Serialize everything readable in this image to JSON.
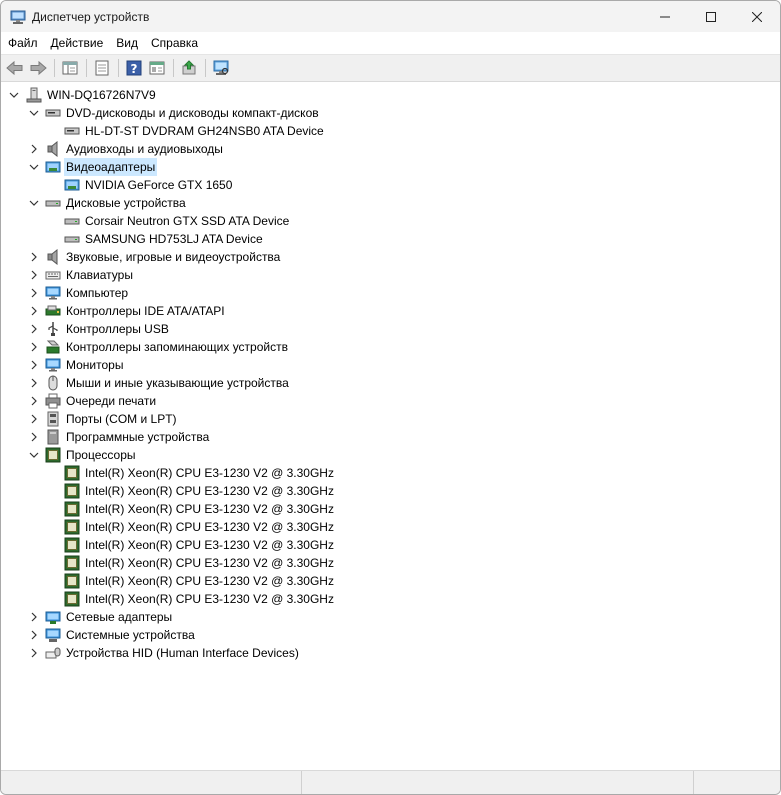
{
  "window": {
    "title": "Диспетчер устройств"
  },
  "menu": [
    "Файл",
    "Действие",
    "Вид",
    "Справка"
  ],
  "toolbar_icons": [
    "back-icon",
    "forward-icon",
    "show-hide-tree-icon",
    "properties-icon",
    "help-icon",
    "run-view-icon",
    "update-driver-icon",
    "scan-hardware-icon"
  ],
  "tree": {
    "root": "WIN-DQ16726N7V9",
    "categories": [
      {
        "label": "DVD-дисководы и дисководы компакт-дисков",
        "icon": "dvd-drive-icon",
        "expanded": true,
        "children": [
          "HL-DT-ST DVDRAM GH24NSB0 ATA Device"
        ]
      },
      {
        "label": "Аудиовходы и аудиовыходы",
        "icon": "speaker-icon",
        "expanded": false,
        "children": []
      },
      {
        "label": "Видеоадаптеры",
        "icon": "display-adapter-icon",
        "expanded": true,
        "selected": true,
        "children": [
          "NVIDIA GeForce GTX 1650"
        ]
      },
      {
        "label": "Дисковые устройства",
        "icon": "disk-drive-icon",
        "expanded": true,
        "children": [
          "Corsair Neutron GTX SSD ATA Device",
          "SAMSUNG HD753LJ ATA Device"
        ]
      },
      {
        "label": "Звуковые, игровые и видеоустройства",
        "icon": "speaker-icon",
        "expanded": false,
        "children": []
      },
      {
        "label": "Клавиатуры",
        "icon": "keyboard-icon",
        "expanded": false,
        "children": []
      },
      {
        "label": "Компьютер",
        "icon": "monitor-icon",
        "expanded": false,
        "children": []
      },
      {
        "label": "Контроллеры IDE ATA/ATAPI",
        "icon": "ide-controller-icon",
        "expanded": false,
        "children": []
      },
      {
        "label": "Контроллеры USB",
        "icon": "usb-icon",
        "expanded": false,
        "children": []
      },
      {
        "label": "Контроллеры запоминающих устройств",
        "icon": "storage-controller-icon",
        "expanded": false,
        "children": []
      },
      {
        "label": "Мониторы",
        "icon": "monitor-icon",
        "expanded": false,
        "children": []
      },
      {
        "label": "Мыши и иные указывающие устройства",
        "icon": "mouse-icon",
        "expanded": false,
        "children": []
      },
      {
        "label": "Очереди печати",
        "icon": "printer-icon",
        "expanded": false,
        "children": []
      },
      {
        "label": "Порты (COM и LPT)",
        "icon": "port-icon",
        "expanded": false,
        "children": []
      },
      {
        "label": "Программные устройства",
        "icon": "software-device-icon",
        "expanded": false,
        "children": []
      },
      {
        "label": "Процессоры",
        "icon": "processor-icon",
        "expanded": true,
        "children": [
          "Intel(R) Xeon(R) CPU E3-1230 V2 @ 3.30GHz",
          "Intel(R) Xeon(R) CPU E3-1230 V2 @ 3.30GHz",
          "Intel(R) Xeon(R) CPU E3-1230 V2 @ 3.30GHz",
          "Intel(R) Xeon(R) CPU E3-1230 V2 @ 3.30GHz",
          "Intel(R) Xeon(R) CPU E3-1230 V2 @ 3.30GHz",
          "Intel(R) Xeon(R) CPU E3-1230 V2 @ 3.30GHz",
          "Intel(R) Xeon(R) CPU E3-1230 V2 @ 3.30GHz",
          "Intel(R) Xeon(R) CPU E3-1230 V2 @ 3.30GHz"
        ]
      },
      {
        "label": "Сетевые адаптеры",
        "icon": "network-adapter-icon",
        "expanded": false,
        "children": []
      },
      {
        "label": "Системные устройства",
        "icon": "system-device-icon",
        "expanded": false,
        "children": []
      },
      {
        "label": "Устройства HID (Human Interface Devices)",
        "icon": "hid-icon",
        "expanded": false,
        "children": []
      }
    ]
  },
  "colors": {
    "selection": "#cce8ff",
    "titlebar": "#f3f3f3",
    "toolbar": "#f0f0f0"
  }
}
